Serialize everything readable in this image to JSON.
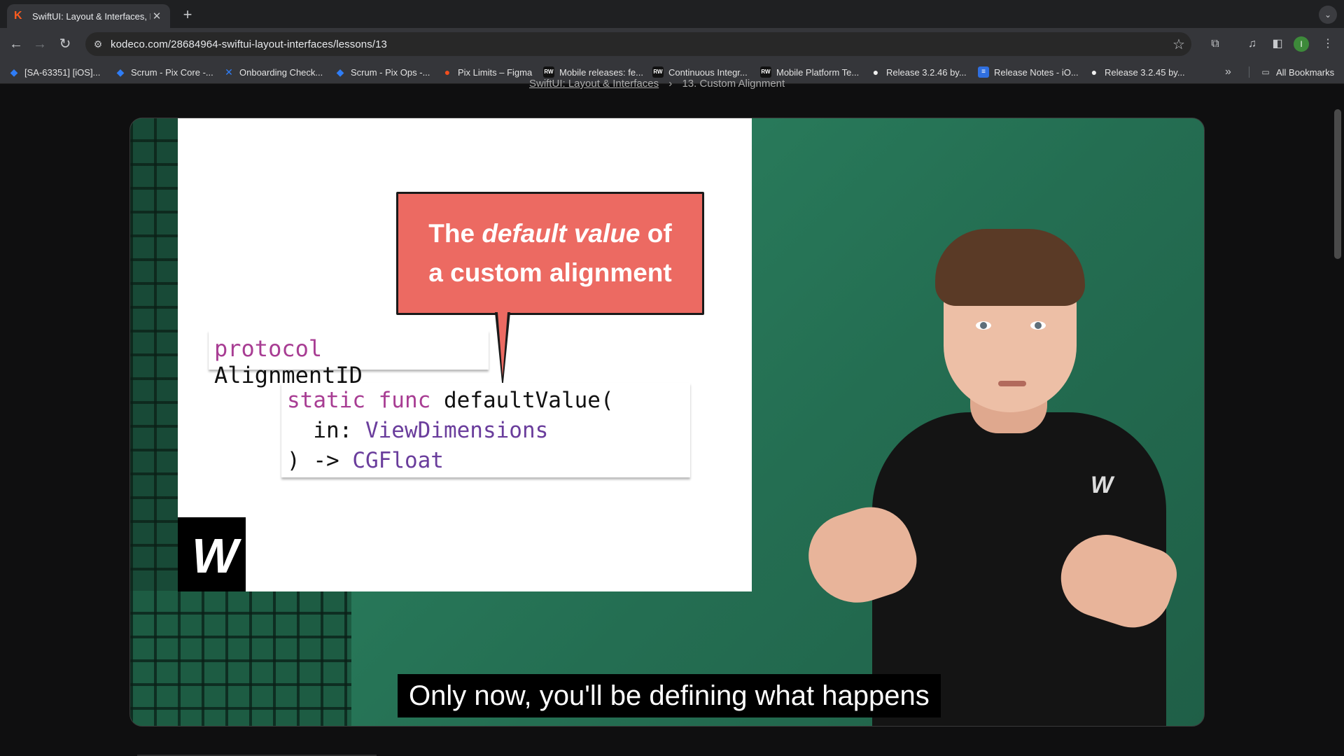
{
  "tab": {
    "title": "SwiftUI: Layout & Interfaces, L"
  },
  "omnibox": {
    "url": "kodeco.com/28684964-swiftui-layout-interfaces/lessons/13"
  },
  "profile_initial": "I",
  "bookmarks": [
    {
      "label": "[SA-63351] [iOS]...",
      "icon": "jira-icon"
    },
    {
      "label": "Scrum - Pix Core -...",
      "icon": "jira-icon"
    },
    {
      "label": "Onboarding Check...",
      "icon": "confluence-icon"
    },
    {
      "label": "Scrum - Pix Ops -...",
      "icon": "jira-icon"
    },
    {
      "label": "Pix Limits – Figma",
      "icon": "figma-icon"
    },
    {
      "label": "Mobile releases: fe...",
      "icon": "rw-icon"
    },
    {
      "label": "Continuous Integr...",
      "icon": "rw-icon"
    },
    {
      "label": "Mobile Platform Te...",
      "icon": "rw-icon"
    },
    {
      "label": "Release 3.2.46 by...",
      "icon": "github-icon"
    },
    {
      "label": "Release Notes - iO...",
      "icon": "docs-icon"
    },
    {
      "label": "Release 3.2.45 by...",
      "icon": "github-icon"
    }
  ],
  "all_bookmarks": "All Bookmarks",
  "breadcrumb": {
    "link": "SwiftUI: Layout & Interfaces",
    "separator": "›",
    "current": "13. Custom Alignment"
  },
  "slide": {
    "bubble_line1_pre": "The ",
    "bubble_line1_em": "default value",
    "bubble_line1_post": " of",
    "bubble_line2": "a custom alignment",
    "code_proto_kw": "protocol",
    "code_proto_name": " AlignmentID",
    "code_func_kw": "static func",
    "code_func_name": " defaultValue(",
    "code_param": "  in: ",
    "code_param_type": "ViewDimensions",
    "code_return": ") -> ",
    "code_return_type": "CGFloat"
  },
  "caption": "Only now, you'll be defining what happens",
  "colors": {
    "bubble": "#ec6a62",
    "keyword": "#a83d93",
    "type": "#6a3d9c",
    "green_bg": "#2f8c67"
  }
}
